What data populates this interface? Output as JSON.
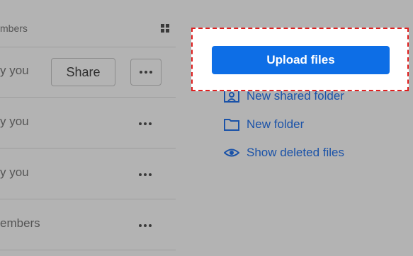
{
  "file_list": {
    "header_text": "mbers",
    "rows": [
      {
        "text": "y you"
      },
      {
        "text": "y you"
      },
      {
        "text": "y you"
      },
      {
        "text": "embers"
      }
    ],
    "share_label": "Share"
  },
  "actions": {
    "upload_label": "Upload files",
    "new_shared_folder_label": "New shared folder",
    "new_folder_label": "New folder",
    "show_deleted_label": "Show deleted files"
  },
  "colors": {
    "primary_button": "#0d6ee6",
    "link": "#1a52a8",
    "highlight_border": "#e01f1f",
    "overlay": "#b3b3b3"
  },
  "icons": [
    "grid-view-icon",
    "more-icon",
    "shared-folder-icon",
    "folder-icon",
    "eye-icon"
  ]
}
